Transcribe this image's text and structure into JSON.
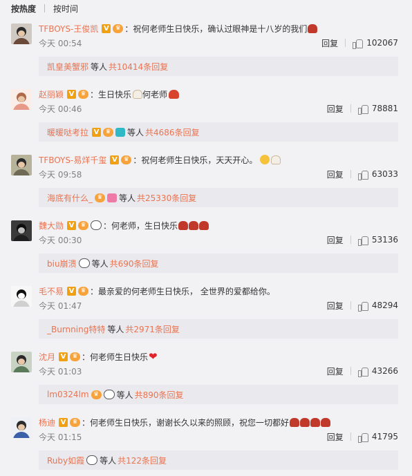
{
  "sort": {
    "hot": "按热度",
    "time": "按时间"
  },
  "reply_label": "回复",
  "suffix_etc": "等人",
  "comments": [
    {
      "user": "TFBOYS-王俊凯",
      "text": "：祝何老师生日快乐，确认过眼神是十八岁的我们",
      "time": "今天 00:54",
      "likes": "102067",
      "sub_user": "凯皇美蟹邪",
      "sub_count": "共10414条回复",
      "avatar_color": "#6b4a3a"
    },
    {
      "user": "赵丽颖",
      "text_a": "：生日快乐",
      "text_b": "何老师",
      "time": "今天 00:46",
      "likes": "78881",
      "sub_user": "暖暖哒考拉",
      "sub_count": "共4686条回复",
      "avatar_color": "#e89a8a"
    },
    {
      "user": "TFBOYS-易烊千玺",
      "text": "：祝何老师生日快乐，天天开心。",
      "time": "今天 09:58",
      "likes": "63033",
      "sub_user": "海底有什么_",
      "sub_count": "共25330条回复",
      "avatar_color": "#6e6a55"
    },
    {
      "user": "魏大勋",
      "text": "：何老师，生日快乐",
      "time": "今天 00:30",
      "likes": "53136",
      "sub_user": "biu崩溃",
      "sub_count": "共690条回复",
      "avatar_color": "#1e1e1e"
    },
    {
      "user": "毛不易",
      "text": "：最亲爱的何老师生日快乐， 全世界的爱都给你。",
      "time": "今天 01:47",
      "likes": "48294",
      "sub_user": "_Burnning特特",
      "sub_count": "共2971条回复",
      "avatar_color": "#f4f4f4"
    },
    {
      "user": "沈月",
      "text": "：何老师生日快乐",
      "time": "今天 01:03",
      "likes": "43266",
      "sub_user": "lm0324lm",
      "sub_count": "共890条回复",
      "avatar_color": "#5a7a5a"
    },
    {
      "user": "杨迪",
      "text": "：何老师生日快乐，谢谢长久以来的照顾，祝您一切都好",
      "time": "今天 01:15",
      "likes": "41795",
      "sub_user": "Ruby如霞",
      "sub_count": "共122条回复",
      "avatar_color": "#3b5fa8"
    }
  ]
}
